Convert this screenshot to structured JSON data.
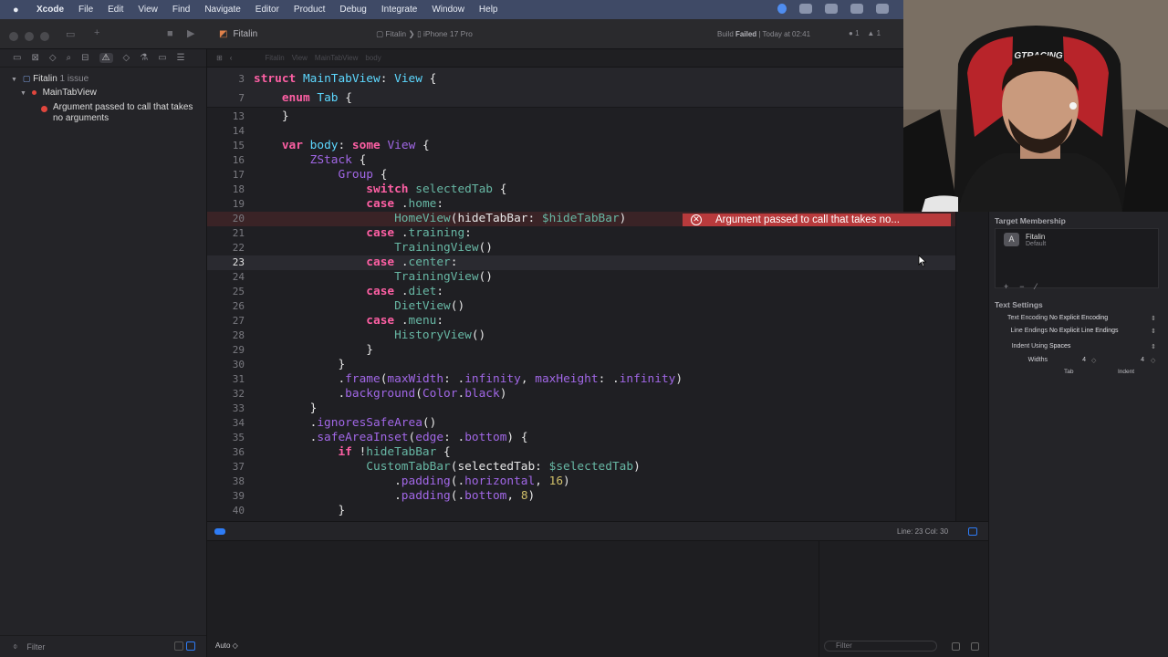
{
  "menubar": {
    "app": "Xcode",
    "items": [
      "File",
      "Edit",
      "View",
      "Find",
      "Navigate",
      "Editor",
      "Product",
      "Debug",
      "Integrate",
      "Window",
      "Help"
    ]
  },
  "toolbar": {
    "tab_title": "Fitalin",
    "scheme": "Fitalin",
    "separator": "❯",
    "destination": "iPhone 17 Pro",
    "status_prefix": "Build",
    "status_failed": "Failed",
    "status_suffix": "| Today at 02:41",
    "error_count": "1",
    "warning_count": "1"
  },
  "navigator": {
    "project": "Fitalin",
    "issue_count": "1 issue",
    "file": "MainTabView",
    "issue": "Argument passed to call that takes no arguments",
    "filter_placeholder": "Filter"
  },
  "jumpbar": [
    "Fitalin",
    "View",
    "MainTabView",
    "body"
  ],
  "editor": {
    "error_message": "Argument passed to call that takes no..."
  },
  "debug": {
    "position": "Line: 23  Col: 30",
    "output_mode": "Auto ◇",
    "filter_placeholder": "Filter"
  },
  "inspector": {
    "target_membership": "Target Membership",
    "target_name": "Fitalin",
    "target_sub": "Default",
    "text_settings": "Text Settings",
    "encoding_label": "Text Encoding",
    "encoding_value": "No Explicit Encoding",
    "line_endings_label": "Line Endings",
    "line_endings_value": "No Explicit Line Endings",
    "indent_label": "Indent Using",
    "indent_value": "Spaces",
    "widths_label": "Widths",
    "tab_width": "4",
    "indent_width": "4",
    "tab_label": "Tab",
    "indent_sublabel": "Indent"
  },
  "webcam": {
    "chair_brand": "GTRACING"
  }
}
